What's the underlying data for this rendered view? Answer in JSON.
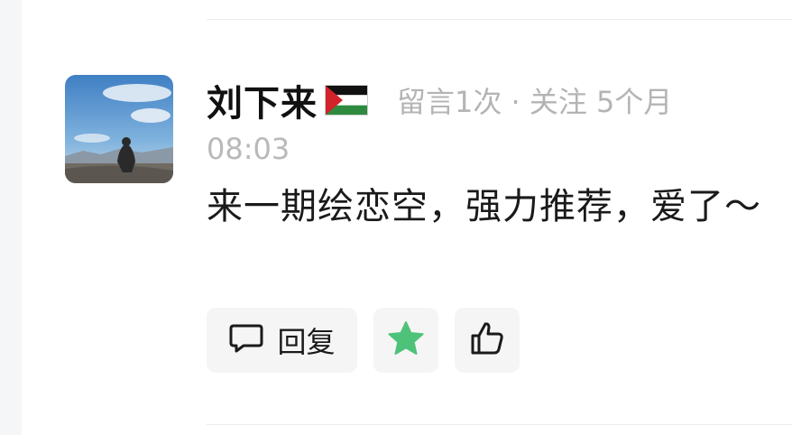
{
  "comment": {
    "username": "刘下来",
    "meta": "留言1次 · 关注 5个月",
    "time": "08:03",
    "text": "来一期绘恋空，强力推荐，爱了～"
  },
  "actions": {
    "reply_label": "回复"
  },
  "colors": {
    "star": "#4fc27a",
    "muted_text": "#b4b4b4",
    "button_bg": "#f5f5f5"
  },
  "icons": {
    "reply": "speech-bubble-icon",
    "favorite": "star-icon",
    "like": "thumbs-up-icon",
    "flag": "palestine-flag-icon"
  }
}
